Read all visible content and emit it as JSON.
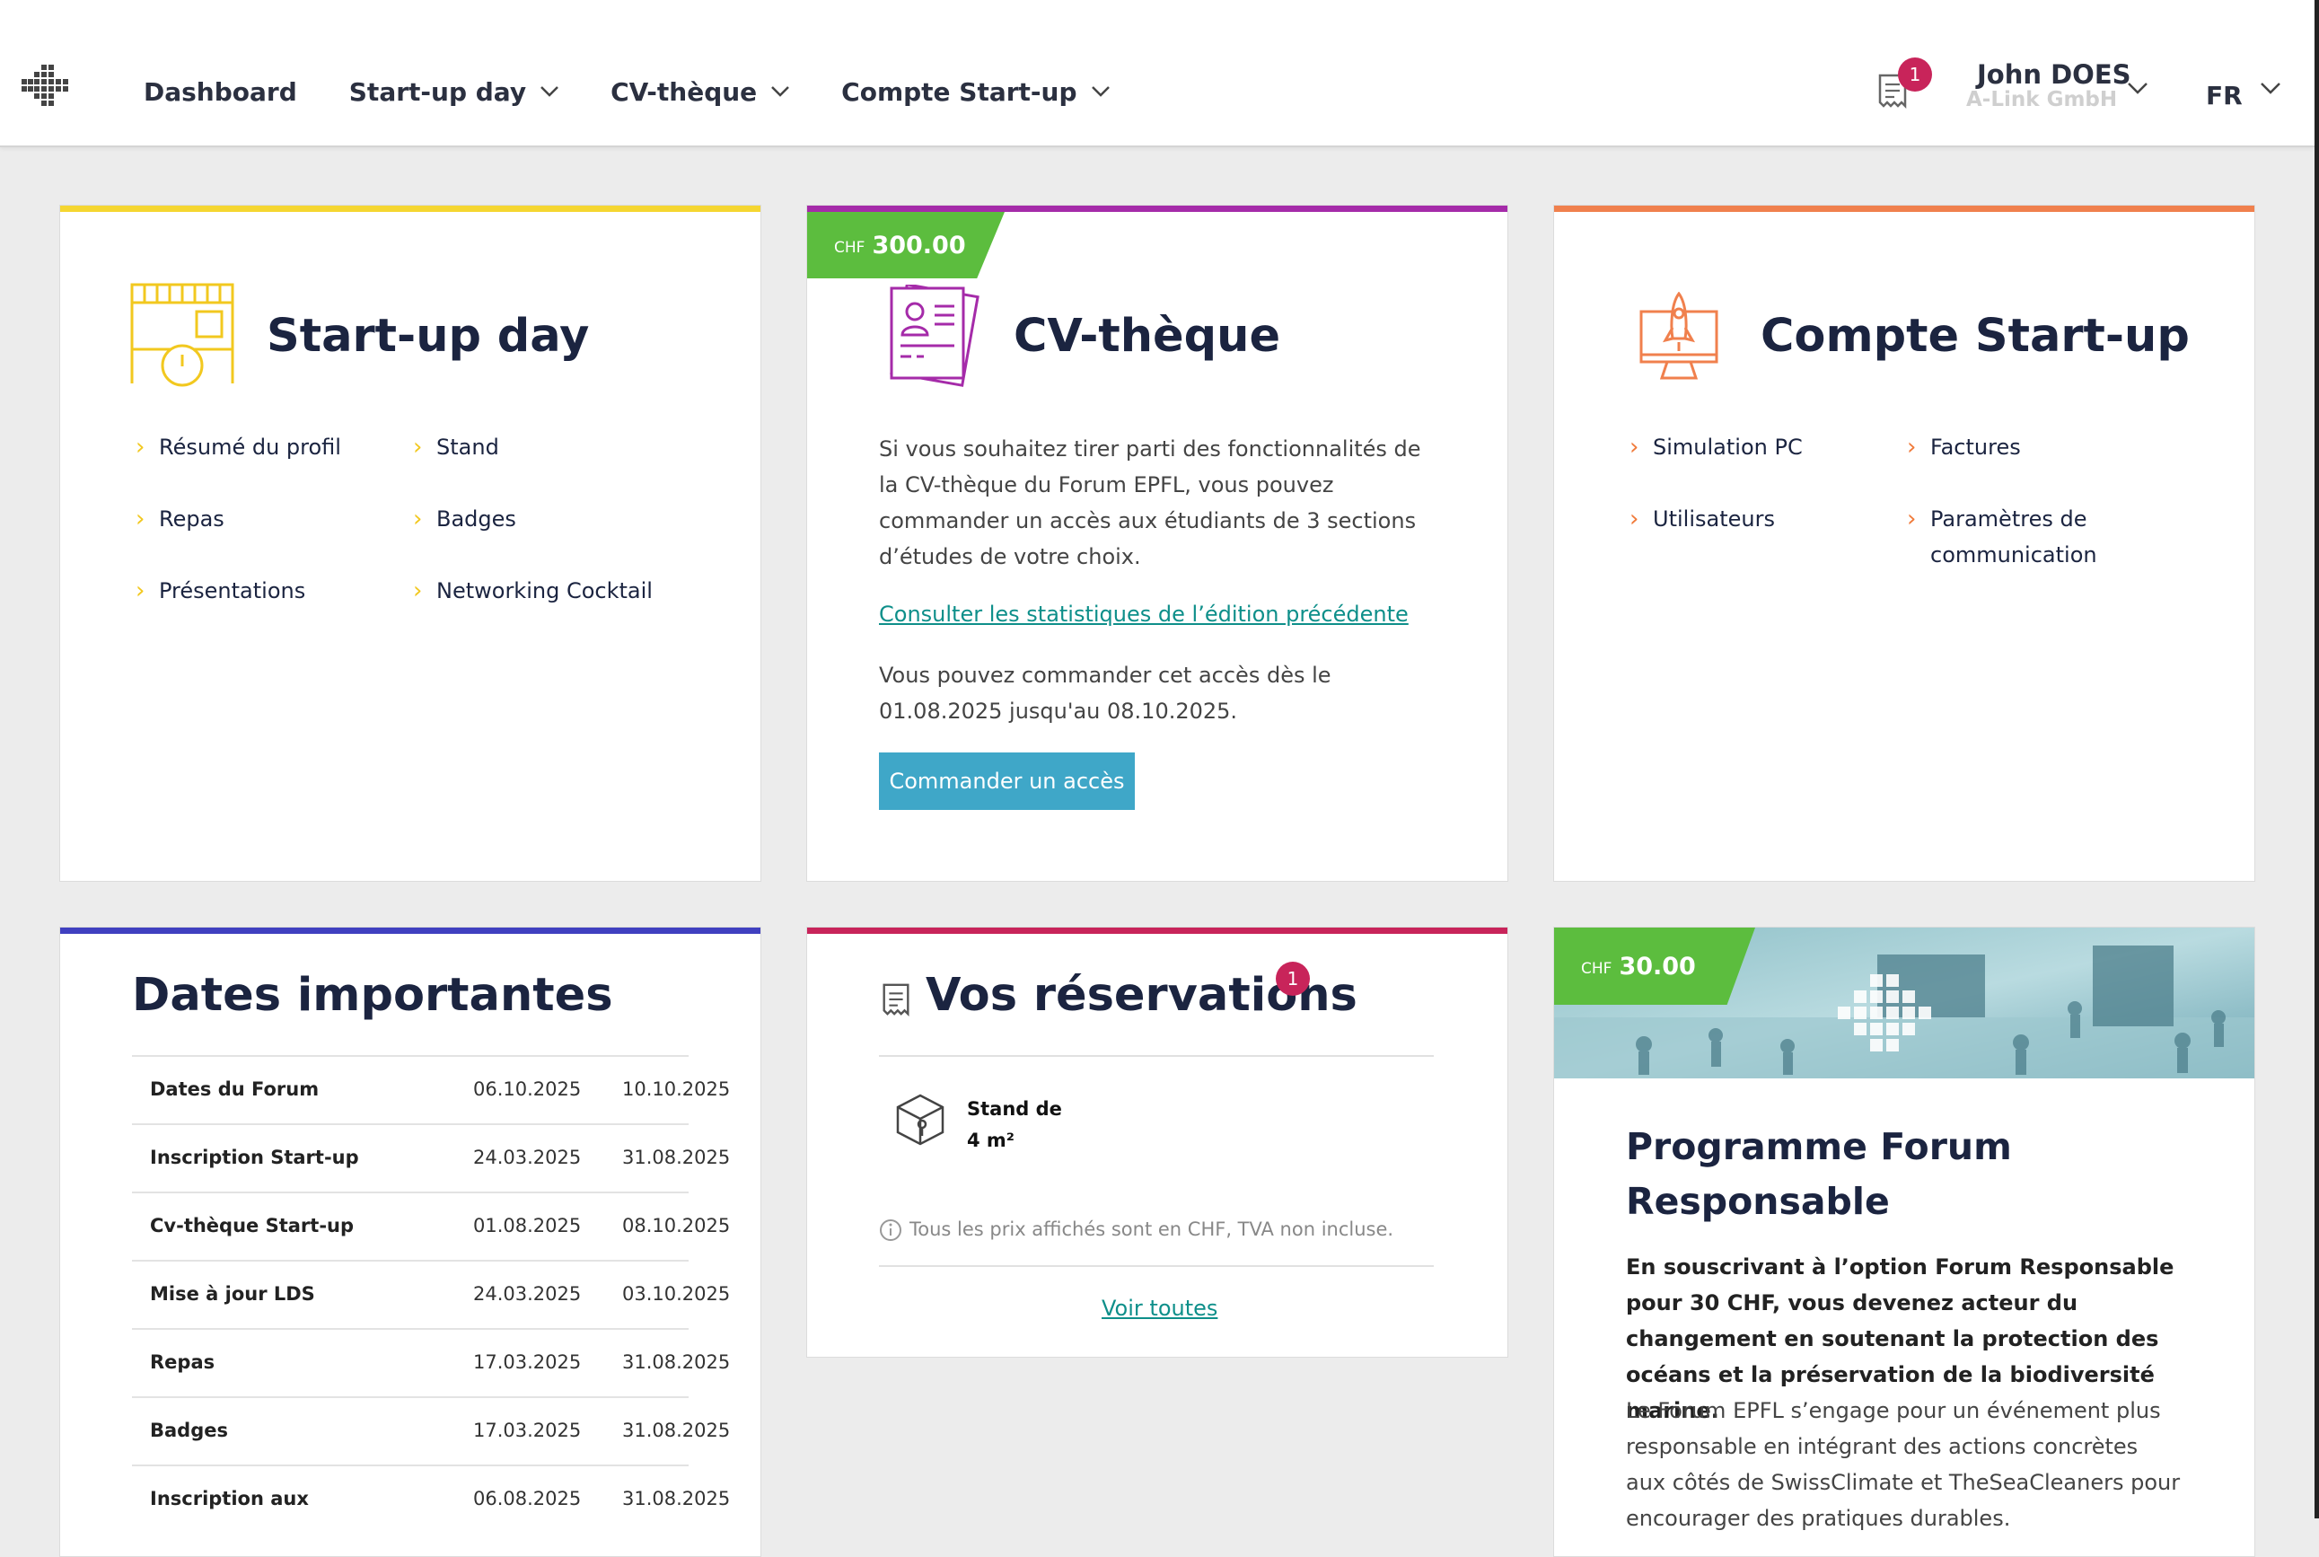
{
  "header": {
    "nav": [
      {
        "label": "Dashboard",
        "has_menu": false
      },
      {
        "label": "Start-up day",
        "has_menu": true
      },
      {
        "label": "CV-thèque",
        "has_menu": true
      },
      {
        "label": "Compte Start-up",
        "has_menu": true
      }
    ],
    "cart_count": "1",
    "user_name": "John DOES",
    "user_company": "A-Link GmbH",
    "language": "FR"
  },
  "startup_day": {
    "title": "Start-up day",
    "accent": "#f5d631",
    "links": [
      "Résumé du profil",
      "Stand",
      "Repas",
      "Badges",
      "Présentations",
      "Networking Cocktail"
    ]
  },
  "cvtheque": {
    "title": "CV-thèque",
    "accent": "#a52ba9",
    "price_currency": "CHF",
    "price": "300.00",
    "description": "Si vous souhaitez tirer parti des fonctionnalités de la CV-thèque du Forum EPFL, vous pouvez commander un accès aux étudiants de 3 sections d’études de votre choix.",
    "stats_link": "Consulter les statistiques de l’édition précédente",
    "availability": "Vous pouvez commander cet accès dès le 01.08.2025 jusqu'au 08.10.2025.",
    "order_button": "Commander un accès"
  },
  "compte_startup": {
    "title": "Compte Start-up",
    "accent": "#f0804d",
    "links": [
      "Simulation PC",
      "Factures",
      "Utilisateurs",
      "Paramètres de communication"
    ]
  },
  "dates": {
    "title": "Dates importantes",
    "accent": "#4040c0",
    "rows": [
      {
        "label": "Dates du Forum",
        "start": "06.10.2025",
        "end": "10.10.2025"
      },
      {
        "label": "Inscription Start-up",
        "start": "24.03.2025",
        "end": "31.08.2025"
      },
      {
        "label": "Cv-thèque Start-up",
        "start": "01.08.2025",
        "end": "08.10.2025"
      },
      {
        "label": "Mise à jour LDS",
        "start": "24.03.2025",
        "end": "03.10.2025"
      },
      {
        "label": "Repas",
        "start": "17.03.2025",
        "end": "31.08.2025"
      },
      {
        "label": "Badges",
        "start": "17.03.2025",
        "end": "31.08.2025"
      },
      {
        "label": "Inscription aux",
        "start": "06.08.2025",
        "end": "31.08.2025"
      }
    ]
  },
  "reservations": {
    "title": "Vos réservations",
    "accent": "#c8245a",
    "count": "1",
    "item_line1": "Stand de",
    "item_line2": "4 m²",
    "note": "Tous les prix affichés sont en CHF, TVA non incluse.",
    "see_all": "Voir toutes"
  },
  "forum_responsable": {
    "price_currency": "CHF",
    "price": "30.00",
    "title": "Programme Forum Responsable",
    "bold_text": "En souscrivant à l’option Forum Responsable pour 30 CHF, vous devenez acteur du changement en soutenant la protection des océans et la préservation de la biodiversité marine.",
    "text": "Le Forum EPFL s’engage pour un événement plus responsable en intégrant des actions concrètes aux côtés de SwissClimate et TheSeaCleaners pour encourager des pratiques durables."
  }
}
